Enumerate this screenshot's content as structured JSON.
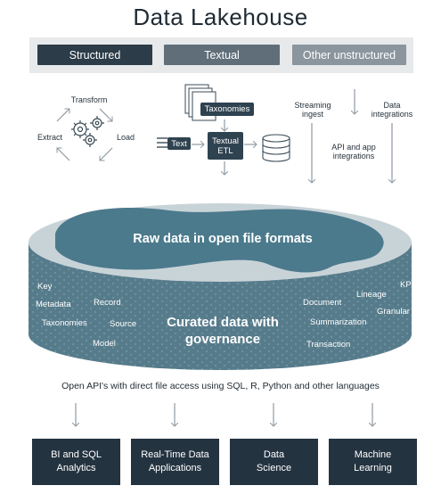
{
  "title": "Data Lakehouse",
  "categories": [
    {
      "label": "Structured",
      "color": "#2c3c48"
    },
    {
      "label": "Textual",
      "color": "#5f6e79"
    },
    {
      "label": "Other unstructured",
      "color": "#8a959d"
    }
  ],
  "etl": {
    "transform": "Transform",
    "extract": "Extract",
    "load": "Load"
  },
  "textual": {
    "taxonomies": "Taxonomies",
    "text": "Text",
    "textual_etl": "Textual ETL"
  },
  "ingest": {
    "streaming": "Streaming ingest",
    "data_integrations": "Data integrations",
    "api_integrations": "API and app integrations"
  },
  "lake": {
    "raw": "Raw data in open file formats",
    "curated": "Curated data with governance",
    "terms_left": [
      "Key",
      "Metadata",
      "Record",
      "Taxonomies",
      "Source",
      "Model"
    ],
    "terms_right": [
      "KPI",
      "Lineage",
      "Document",
      "Granular",
      "Summarization",
      "Transaction"
    ],
    "colors": {
      "top": "#c5d1d6",
      "raw": "#4a7a8c",
      "side": "#4e7484"
    }
  },
  "api_line": "Open API's with direct file access using SQL, R, Python and other languages",
  "consumers": [
    "BI and SQL Analytics",
    "Real-Time Data Applications",
    "Data Science",
    "Machine Learning"
  ]
}
